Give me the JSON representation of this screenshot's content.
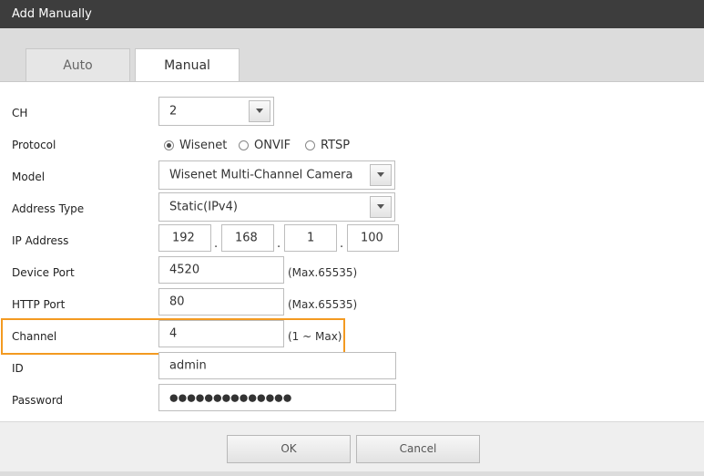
{
  "window": {
    "title": "Add Manually"
  },
  "tabs": [
    {
      "label": "Auto",
      "active": false
    },
    {
      "label": "Manual",
      "active": true
    }
  ],
  "form": {
    "ch": {
      "label": "CH",
      "value": "2"
    },
    "protocol": {
      "label": "Protocol",
      "options": [
        "Wisenet",
        "ONVIF",
        "RTSP"
      ],
      "selected": "Wisenet"
    },
    "model": {
      "label": "Model",
      "value": "Wisenet Multi-Channel Camera"
    },
    "address_type": {
      "label": "Address Type",
      "value": "Static(IPv4)"
    },
    "ip_address": {
      "label": "IP Address",
      "octets": [
        "192",
        "168",
        "1",
        "100"
      ],
      "separator": "."
    },
    "device_port": {
      "label": "Device Port",
      "value": "4520",
      "hint": "(Max.65535)"
    },
    "http_port": {
      "label": "HTTP Port",
      "value": "80",
      "hint": "(Max.65535)"
    },
    "channel": {
      "label": "Channel",
      "value": "4",
      "hint": "(1 ~ Max)"
    },
    "id": {
      "label": "ID",
      "value": "admin"
    },
    "password": {
      "label": "Password",
      "value": "●●●●●●●●●●●●●●"
    }
  },
  "footer": {
    "ok_label": "OK",
    "cancel_label": "Cancel"
  },
  "colors": {
    "titlebar": "#3d3d3d",
    "highlight": "#f39a21",
    "tab_bg": "#dcdcdc"
  }
}
